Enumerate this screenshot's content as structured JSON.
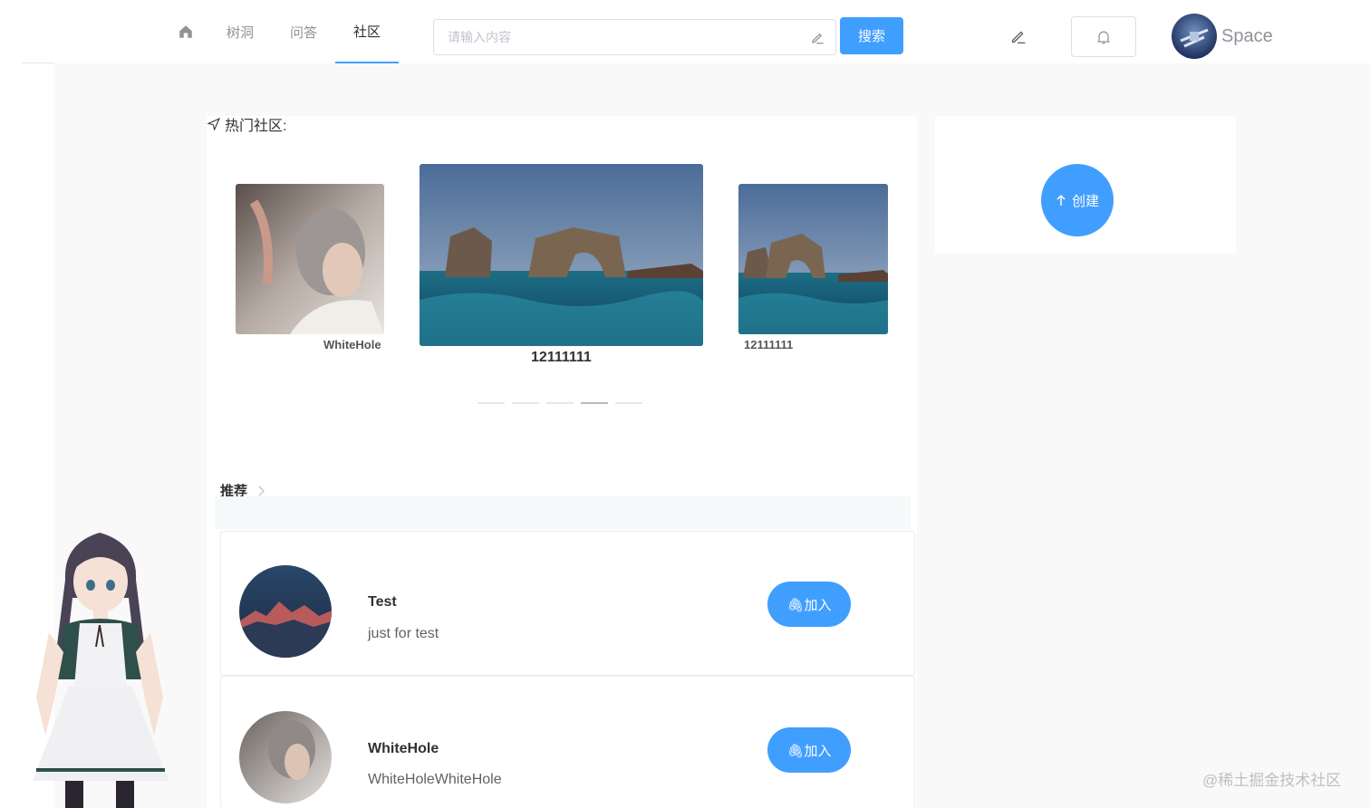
{
  "header": {
    "nav": [
      {
        "label": "",
        "icon": "home-icon"
      },
      {
        "label": "树洞"
      },
      {
        "label": "问答"
      },
      {
        "label": "社区"
      }
    ],
    "search": {
      "placeholder": "请输入内容",
      "button_label": "搜索"
    },
    "user": {
      "name": "Space"
    }
  },
  "hot": {
    "title": "热门社区:",
    "carousel": [
      {
        "caption": "WhiteHole"
      },
      {
        "caption": "12111111"
      },
      {
        "caption": "12111111"
      }
    ],
    "indicator_count": 5,
    "active_indicator": 4
  },
  "recommend": {
    "title": "推荐",
    "items": [
      {
        "name": "Test",
        "desc": "just for test",
        "join_label": "🖇加入"
      },
      {
        "name": "WhiteHole",
        "desc": "WhiteHoleWhiteHole",
        "join_label": "🖇加入"
      }
    ]
  },
  "create": {
    "label": "创建"
  },
  "watermark": "@稀土掘金技术社区",
  "colors": {
    "accent": "#409eff",
    "page_bg": "#f9f9f9",
    "muted_text": "#909399"
  }
}
